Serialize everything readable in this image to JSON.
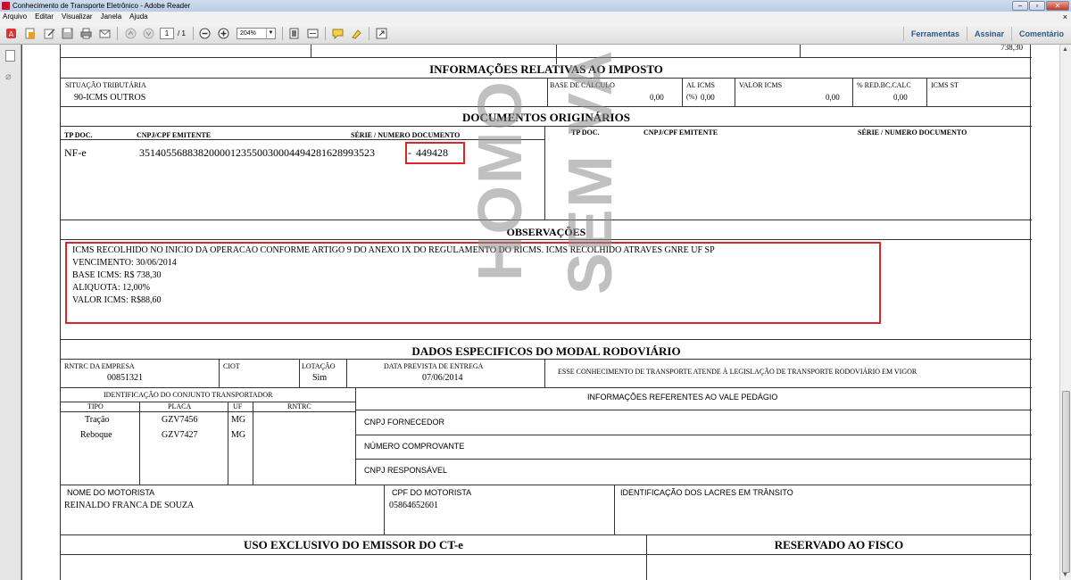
{
  "window": {
    "title": "Conhecimento de Transporte Eletrônico - Adobe Reader"
  },
  "menu": [
    "Arquivo",
    "Editar",
    "Visualizar",
    "Janela",
    "Ajuda"
  ],
  "toolbar": {
    "page_current": "1",
    "page_total": "/ 1",
    "zoom": "204%",
    "links": [
      "Ferramentas",
      "Assinar",
      "Comentário"
    ]
  },
  "doc": {
    "top_value": "738,30",
    "imposto": {
      "title": "INFORMAÇÕES RELATIVAS AO IMPOSTO",
      "situacao_label": "SITUAÇÃO TRIBUTÁRIA",
      "situacao_value": "90-ICMS OUTROS",
      "base_label": "BASE DE CÁLCULO",
      "base_value": "0,00",
      "aliq_label": "AL ICMS",
      "aliq_pct": "(%)",
      "aliq_value": "0,00",
      "valor_label": "VALOR ICMS",
      "valor_value": "0,00",
      "red_label": "% RED.BC.CALC",
      "red_value": "0,00",
      "st_label": "ICMS ST"
    },
    "originarios": {
      "title": "DOCUMENTOS ORIGINÁRIOS",
      "h_tp": "TP DOC.",
      "h_cnpj": "CNPJ/CPF EMITENTE",
      "h_serie": "SÉRIE / NUMERO DOCUMENTO",
      "row_tp": "NF-e",
      "row_key": "35140556883820000123550030004494281628993523",
      "row_sep": "-",
      "row_num": "449428"
    },
    "observacoes": {
      "title": "OBSERVAÇÕES",
      "lines": [
        "ICMS RECOLHIDO NO INICIO DA OPERACAO CONFORME ARTIGO 9 DO ANEXO IX DO REGULAMENTO DO RICMS. ICMS RECOLHIDO ATRAVES GNRE UF SP",
        "VENCIMENTO: 30/06/2014",
        "BASE ICMS: R$ 738,30",
        "ALIQUOTA: 12,00%",
        "VALOR ICMS: R$88,60"
      ]
    },
    "modal": {
      "title": "DADOS ESPECIFICOS DO MODAL RODOVIÁRIO",
      "rntrc_label": "RNTRC DA EMPRESA",
      "rntrc_value": "00851321",
      "ciot_label": "CIOT",
      "lotacao_label": "LOTAÇÃO",
      "lotacao_value": "Sim",
      "data_label": "DATA PREVISTA DE ENTREGA",
      "data_value": "07/06/2014",
      "legal_text": "ESSE CONHECIMENTO DE TRANSPORTE ATENDE À LEGISLAÇÃO DE TRANSPORTE RODOVIÁRIO EM VIGOR",
      "conj_title": "IDENTIFICAÇÃO DO CONJUNTO TRANSPORTADOR",
      "h_tipo": "TIPO",
      "h_placa": "PLACA",
      "h_uf": "UF",
      "h_rntrc": "RNTRC",
      "vehicles": [
        {
          "tipo": "Tração",
          "placa": "GZV7456",
          "uf": "MG"
        },
        {
          "tipo": "Reboque",
          "placa": "GZV7427",
          "uf": "MG"
        }
      ],
      "vale_title": "INFORMAÇÕES REFERENTES AO VALE PEDÁGIO",
      "cnpj_fornecedor": "CNPJ FORNECEDOR",
      "numero_comprovante": "NÚMERO COMPROVANTE",
      "cnpj_responsavel": "CNPJ RESPONSÁVEL",
      "motorista_label": "NOME DO MOTORISTA",
      "motorista_value": "REINALDO FRANCA DE SOUZA",
      "cpf_label": "CPF DO MOTORISTA",
      "cpf_value": "05864652601",
      "lacres_label": "IDENTIFICAÇÃO DOS LACRES EM TRÂNSITO"
    },
    "uso_exclusivo": "USO EXCLUSIVO DO EMISSOR DO CT-e",
    "reservado": "RESERVADO AO FISCO",
    "watermarks": [
      "HOMO",
      "SEM VA"
    ]
  }
}
